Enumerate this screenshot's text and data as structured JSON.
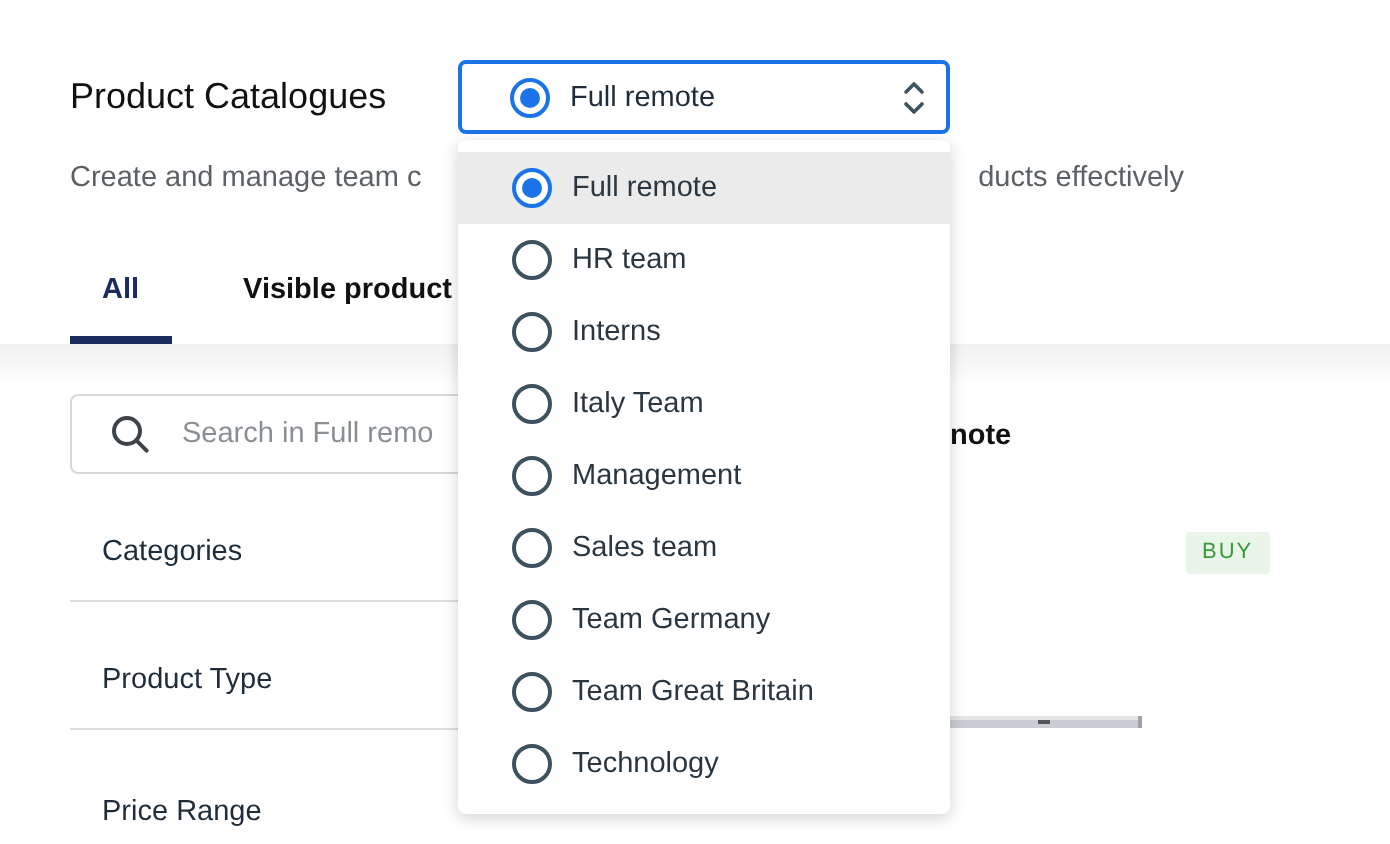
{
  "header": {
    "title": "Product Catalogues",
    "select": {
      "value": "Full remote",
      "open": true
    }
  },
  "subtitle": [
    "Create and manage team c",
    "ducts effectively"
  ],
  "tabs": [
    {
      "label": "All",
      "selected": true
    },
    {
      "label": "Visible product",
      "selected": false
    }
  ],
  "search": {
    "placeholder": "Search in Full remo"
  },
  "filters": [
    "Categories",
    "Product Type",
    "Price Range"
  ],
  "preview": {
    "heading": "note",
    "badge": "BUY"
  },
  "dropdown": {
    "options": [
      {
        "label": "Full remote",
        "selected": true
      },
      {
        "label": "HR team",
        "selected": false
      },
      {
        "label": "Interns",
        "selected": false
      },
      {
        "label": "Italy Team",
        "selected": false
      },
      {
        "label": "Management",
        "selected": false
      },
      {
        "label": "Sales team",
        "selected": false
      },
      {
        "label": "Team Germany",
        "selected": false
      },
      {
        "label": "Team Great Britain",
        "selected": false
      },
      {
        "label": "Technology",
        "selected": false
      }
    ]
  }
}
